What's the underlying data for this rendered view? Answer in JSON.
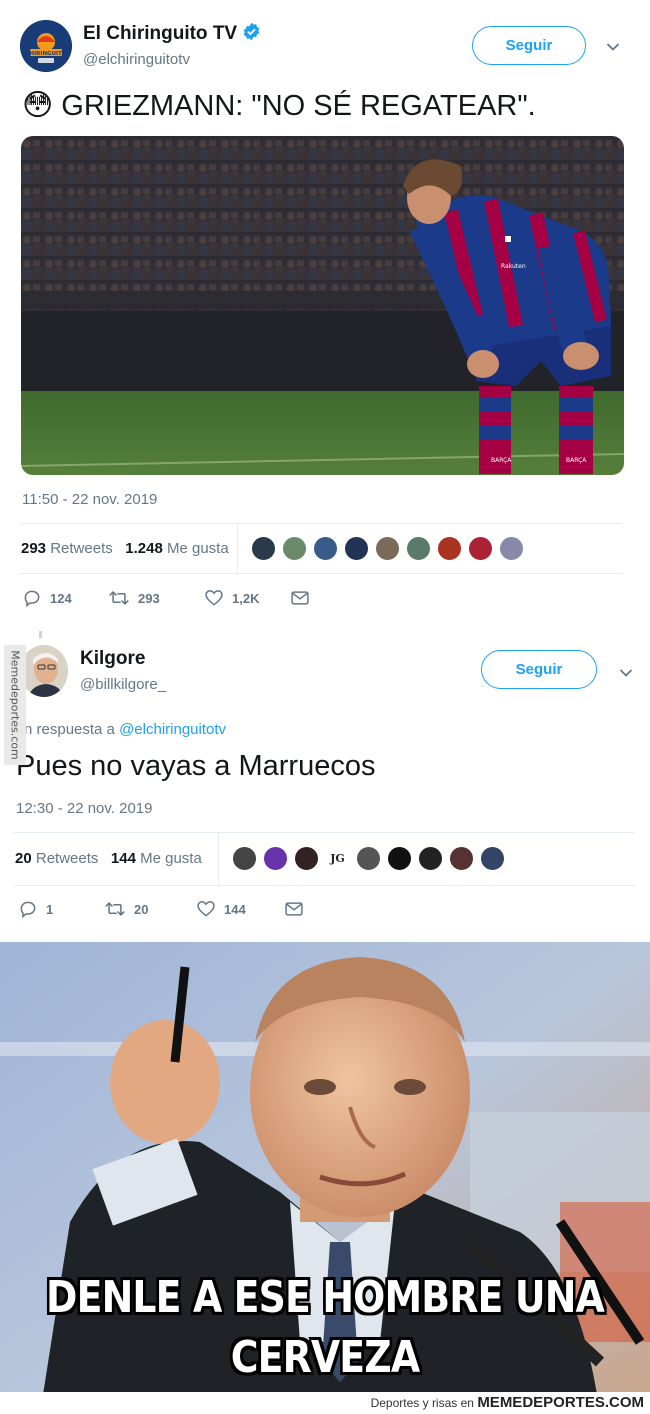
{
  "tweet1": {
    "avatar_logo_text": "CHIRINGUITO",
    "display_name": "El Chiringuito TV",
    "handle": "@elchiringuitotv",
    "follow_label": "Seguir",
    "emoji": "😳",
    "text": "GRIEZMANN: \"NO SÉ REGATEAR\".",
    "timestamp": "11:50 - 22 nov. 2019",
    "retweets_count": "293",
    "retweets_label": "Retweets",
    "likes_count": "1.248",
    "likes_label": "Me gusta",
    "reply_count": "124",
    "retweet_count": "293",
    "like_count": "1,2K",
    "photo_shirt_text_1": "Rakuten",
    "photo_shirt_text_2": "BARÇA",
    "photo_shirt_text_3": "BARÇA",
    "liker_colors": [
      "#2a3a4a",
      "#6a8a6a",
      "#3a5a8a",
      "#223355",
      "#7a6a5a",
      "#5a7a6a",
      "#aa3322",
      "#aa2233",
      "#8888aa"
    ]
  },
  "tweet2": {
    "display_name": "Kilgore",
    "handle": "@billkilgore_",
    "follow_label": "Seguir",
    "reply_prefix": "n respuesta a",
    "reply_handle": "@elchiringuitotv",
    "text": "Pues no vayas a Marruecos",
    "timestamp": "12:30 - 22 nov. 2019",
    "retweets_count": "20",
    "retweets_label": "Retweets",
    "likes_count": "144",
    "likes_label": "Me gusta",
    "liker_initials": "JG",
    "reply_count": "1",
    "retweet_count": "20",
    "like_count": "144",
    "liker_colors": [
      "#444444",
      "#6633aa",
      "#332222",
      "#ffffff",
      "#555555",
      "#111111",
      "#222222",
      "#553333",
      "#334466"
    ]
  },
  "watermark_side": "Memedeportes.com",
  "meme": {
    "caption_line1": "DENLE A ESE HOMBRE UNA",
    "caption_line2": "CERVEZA",
    "footer_small": "Deportes y risas en",
    "footer_brand": "MEMEDEPORTES.COM"
  },
  "colors": {
    "twitter_blue": "#1da1f2",
    "secondary_text": "#657786",
    "divider": "#e6ecf0",
    "barca_blue": "#1b3a8a",
    "barca_red": "#a50044"
  }
}
